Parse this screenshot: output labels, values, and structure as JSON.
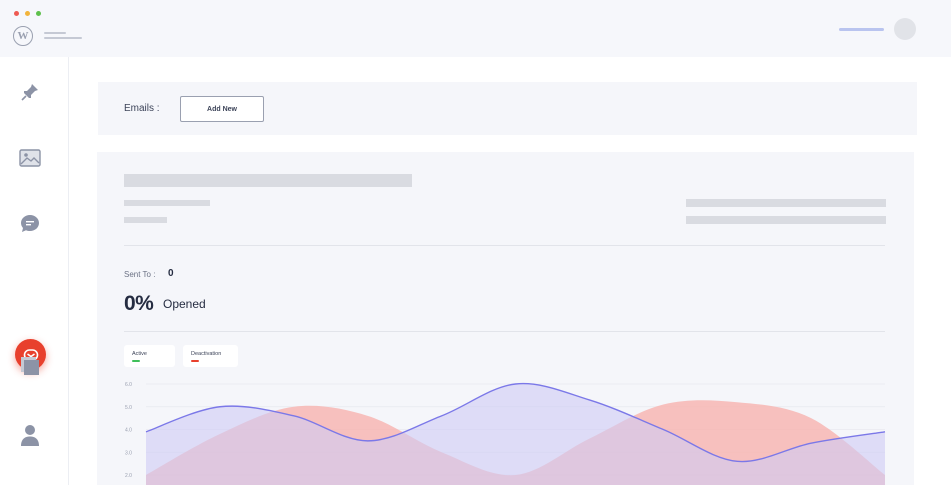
{
  "window": {
    "controls": [
      {
        "name": "close",
        "color": "#ee5a52"
      },
      {
        "name": "minimize",
        "color": "#f2b43b"
      },
      {
        "name": "maximize",
        "color": "#5ec04c"
      }
    ]
  },
  "header": {
    "logo_icon": "wordpress-icon",
    "menu_icon": "hamburger-icon",
    "avatar_icon": "avatar"
  },
  "sidebar": {
    "items": [
      {
        "icon": "pin-icon",
        "active": false
      },
      {
        "icon": "image-icon",
        "active": false
      },
      {
        "icon": "comment-icon",
        "active": false
      },
      {
        "icon": "email-icon",
        "active": true
      },
      {
        "icon": "pages-icon",
        "active": false
      },
      {
        "icon": "user-icon",
        "active": false
      }
    ],
    "active_color": "#e8402d"
  },
  "emails": {
    "label": "Emails :",
    "add_new_label": "Add New"
  },
  "stats": {
    "sent_to_label": "Sent To :",
    "sent_to_value": "0",
    "opened_percent": "0%",
    "opened_label": "Opened"
  },
  "legend": [
    {
      "label": "Active",
      "color": "#3fbf5a"
    },
    {
      "label": "Deactivation",
      "color": "#e8402d"
    }
  ],
  "chart_data": {
    "type": "area",
    "y_ticks": [
      "6.0",
      "5.0",
      "4.0",
      "3.0",
      "2.0"
    ],
    "ylim": [
      2.0,
      6.0
    ],
    "grid": true,
    "series": [
      {
        "color": "#f7b6b3",
        "fill_color": "#f7b6b3",
        "values": [
          2.0,
          3.8,
          5.0,
          4.6,
          3.0,
          2.0,
          3.6,
          5.1,
          5.2,
          4.5,
          2.0
        ]
      },
      {
        "color": "#7b78e8",
        "fill_color": "#cfccf5",
        "values": [
          3.9,
          5.0,
          4.6,
          3.5,
          4.6,
          6.0,
          5.3,
          4.0,
          2.6,
          3.4,
          3.9
        ]
      }
    ]
  }
}
